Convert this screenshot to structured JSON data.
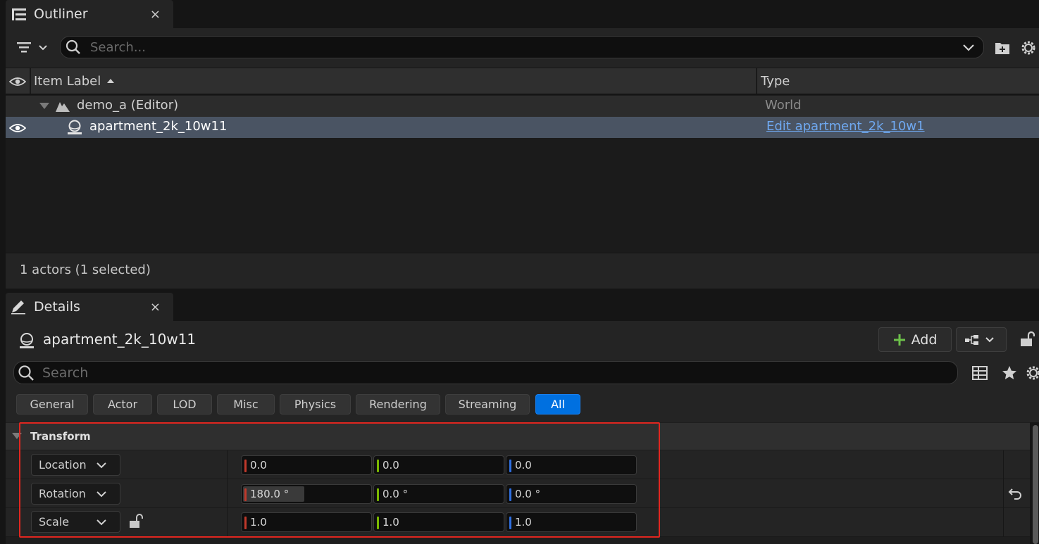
{
  "outliner": {
    "tab_label": "Outliner",
    "close": "×",
    "search_placeholder": "Search...",
    "columns": {
      "label": "Item Label",
      "type": "Type"
    },
    "rows": [
      {
        "label": "demo_a (Editor)",
        "type": "World"
      },
      {
        "label": "apartment_2k_10w11",
        "type": "Edit apartment_2k_10w1"
      }
    ],
    "status": "1 actors (1 selected)"
  },
  "details": {
    "tab_label": "Details",
    "close": "×",
    "actor_name": "apartment_2k_10w11",
    "add_label": "Add",
    "search_placeholder": "Search",
    "filters": [
      "General",
      "Actor",
      "LOD",
      "Misc",
      "Physics",
      "Rendering",
      "Streaming",
      "All"
    ],
    "active_filter": "All",
    "transform": {
      "title": "Transform",
      "rows": [
        {
          "label": "Location",
          "values": [
            "0.0",
            "0.0",
            "0.0"
          ]
        },
        {
          "label": "Rotation",
          "values": [
            "180.0 °",
            "0.0 °",
            "0.0 °"
          ]
        },
        {
          "label": "Scale",
          "values": [
            "1.0",
            "1.0",
            "1.0"
          ]
        }
      ]
    }
  },
  "colors": {
    "x_axis": "#c0392b",
    "y_axis": "#7ab800",
    "z_axis": "#2f6fe0",
    "accent": "#0070e0",
    "highlight_box": "#e0261f",
    "link": "#6fa8f0"
  }
}
